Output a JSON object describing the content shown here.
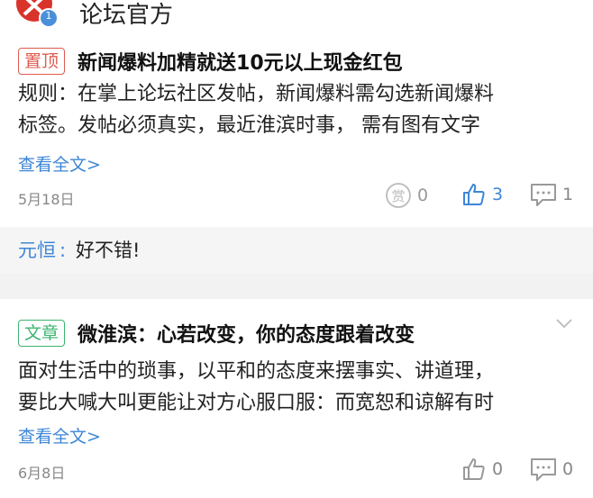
{
  "header": {
    "forum_name": "论坛官方",
    "notification_count": "1"
  },
  "posts": [
    {
      "badge": "置顶",
      "badge_color": "#e05a4e",
      "title": "新闻爆料加精就送10元以上现金红包",
      "body_line1": "规则：在掌上论坛社区发帖，新闻爆料需勾选新闻爆料",
      "body_line2": "标签。发帖必须真实，最近淮滨时事， 需有图有文字",
      "more": "查看全文>",
      "date": "5月18日",
      "reward_count": "0",
      "like_count": "3",
      "comment_count": "1",
      "comment": {
        "user": "元恒",
        "separator": ":",
        "text": "好不错!"
      }
    },
    {
      "badge": "文章",
      "badge_color": "#3cb46e",
      "title": "微淮滨：心若改变，你的态度跟着改变",
      "body_line1": "面对生活中的琐事，以平和的态度来摆事实、讲道理，",
      "body_line2": "要比大喊大叫更能让对方心服口服：而宽恕和谅解有时",
      "more": "查看全文>",
      "date": "6月8日",
      "like_count": "0",
      "comment_count": "0"
    }
  ],
  "colors": {
    "link": "#3d86d6",
    "muted": "#888888",
    "divider": "#f2f2f2"
  }
}
